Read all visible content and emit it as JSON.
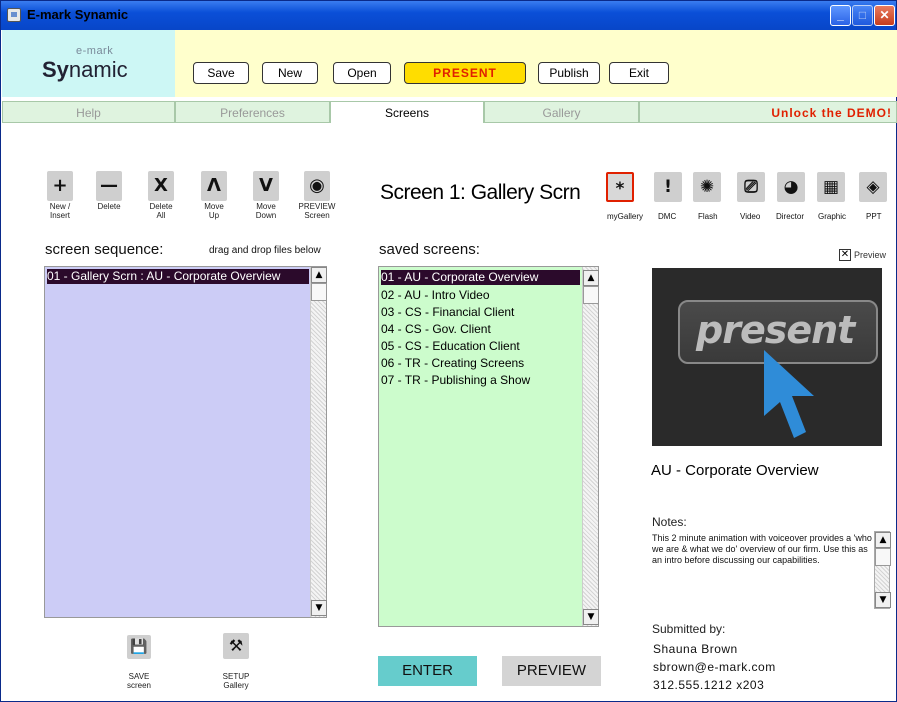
{
  "window": {
    "title": "E-mark Synamic"
  },
  "logo": {
    "small": "e-mark",
    "big_bold": "Sy",
    "big_rest": "namic"
  },
  "toolbar": {
    "save": "Save",
    "new": "New",
    "open": "Open",
    "present": "PRESENT",
    "publish": "Publish",
    "exit": "Exit"
  },
  "tabs": {
    "help": "Help",
    "preferences": "Preferences",
    "screens": "Screens",
    "gallery": "Gallery",
    "unlock": "Unlock the DEMO!"
  },
  "sequence_tools": [
    {
      "glyph": "+",
      "label": "New /\nInsert"
    },
    {
      "glyph": "—",
      "label": "Delete"
    },
    {
      "glyph": "X",
      "label": "Delete\nAll"
    },
    {
      "glyph": "Λ",
      "label": "Move\nUp"
    },
    {
      "glyph": "V",
      "label": "Move\nDown"
    },
    {
      "glyph": "◉",
      "label": "PREVIEW\nScreen"
    }
  ],
  "sequence": {
    "title": "screen sequence:",
    "hint": "drag and drop files below",
    "items": [
      "01 - Gallery Scrn : AU - Corporate Overview"
    ]
  },
  "screen_title": "Screen 1: Gallery Scrn",
  "saved": {
    "title": "saved screens:",
    "items": [
      "01 - AU - Corporate Overview",
      "02 - AU - Intro Video",
      "03 - CS - Financial Client",
      "04 - CS - Gov. Client",
      "05 - CS - Education Client",
      "06 - TR - Creating Screens",
      "07 - TR - Publishing a Show"
    ]
  },
  "type_icons": [
    {
      "glyph": "*",
      "label": "myGallery",
      "icon": "star-icon"
    },
    {
      "glyph": "!",
      "label": "DMC",
      "icon": "exclamation-icon"
    },
    {
      "glyph": "✺",
      "label": "Flash",
      "icon": "flash-icon"
    },
    {
      "glyph": "⎚",
      "label": "Video",
      "icon": "video-icon"
    },
    {
      "glyph": "◕",
      "label": "Director",
      "icon": "director-icon"
    },
    {
      "glyph": "▦",
      "label": "Graphic",
      "icon": "graphic-icon"
    },
    {
      "glyph": "◈",
      "label": "PPT",
      "icon": "ppt-icon"
    }
  ],
  "preview": {
    "checkbox_label": "Preview",
    "image_text": "present",
    "screen_name": "AU - Corporate Overview",
    "notes_label": "Notes:",
    "notes": "This 2 minute animation with voiceover provides a 'who we are & what we do' overview of our firm. Use this as an intro before discussing our capabilities.",
    "submitted_label": "Submitted by:",
    "name": "Shauna Brown",
    "email": "sbrown@e-mark.com",
    "phone": "312.555.1212 x203"
  },
  "bottom": {
    "save_screen": "SAVE\nscreen",
    "setup_gallery": "SETUP\nGallery",
    "enter": "ENTER",
    "preview": "PREVIEW"
  },
  "colors": {
    "sequence_bg": "#ccccf6",
    "saved_bg": "#ccfccc",
    "enter_bg": "#66cccc",
    "preview_btn_bg": "#d4d4d4",
    "accent_red": "#e02000",
    "present_yellow": "#ffdd00"
  }
}
